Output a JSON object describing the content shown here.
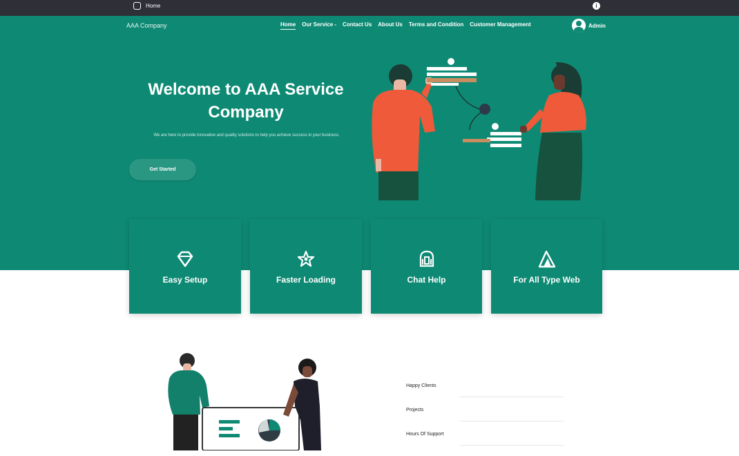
{
  "topbar": {
    "left_label": "Home",
    "right_icon": "info-icon"
  },
  "nav": {
    "brand": "AAA Company",
    "items": [
      {
        "label": "Home",
        "active": true
      },
      {
        "label": "Our Service -"
      },
      {
        "label": "Contact Us"
      },
      {
        "label": "About Us"
      },
      {
        "label": "Terms and Condition"
      },
      {
        "label": "Customer Management"
      }
    ],
    "user_name": "Admin"
  },
  "hero": {
    "title": "Welcome to AAA Service Company",
    "subtitle": "We are here to provide innovative and quality solutions to help you achieve success in your business.",
    "cta": "Get Started",
    "accent_color": "#0e8a74"
  },
  "features": [
    {
      "label": "Easy Setup",
      "icon": "diamond-icon"
    },
    {
      "label": "Faster Loading",
      "icon": "star-icon"
    },
    {
      "label": "Chat Help",
      "icon": "chat-icon"
    },
    {
      "label": "For All Type Web",
      "icon": "mountain-icon"
    }
  ],
  "form": {
    "fields": [
      "Happy Clients",
      "Projects",
      "Hours Of Support"
    ]
  }
}
